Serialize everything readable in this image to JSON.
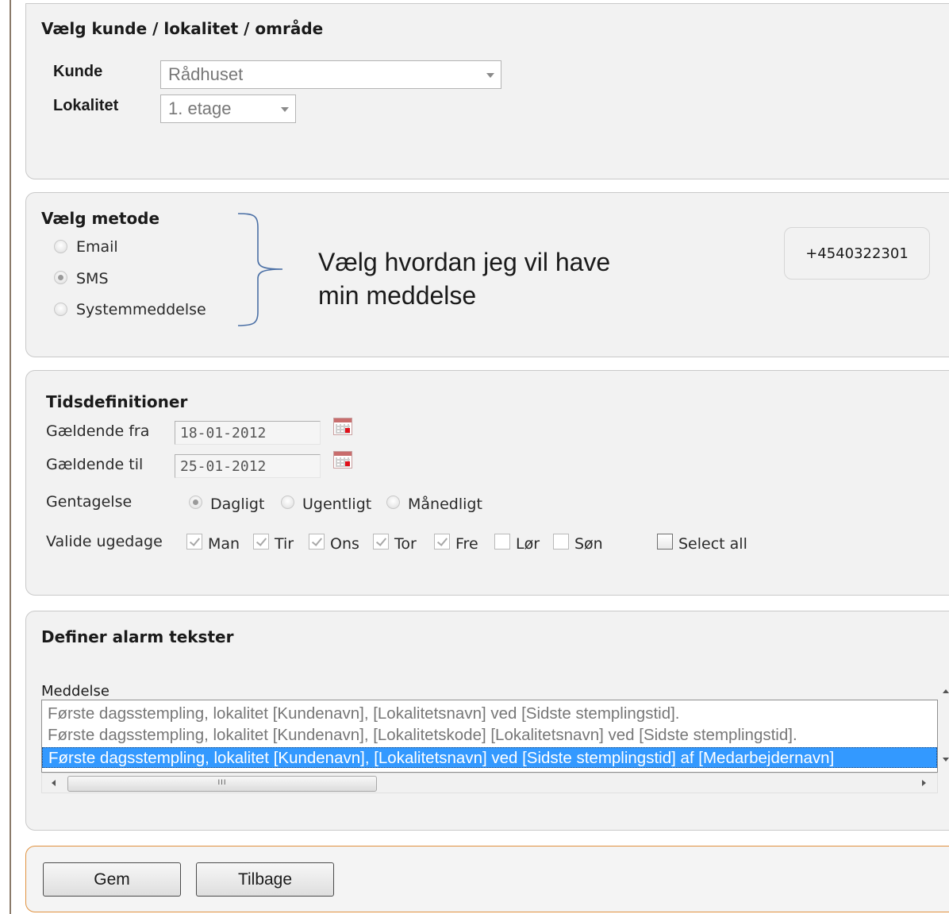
{
  "customer_section": {
    "title": "Vælg kunde / lokalitet / område",
    "customer_label": "Kunde",
    "customer_value": "Rådhuset",
    "location_label": "Lokalitet",
    "location_value": "1. etage"
  },
  "method_section": {
    "title": "Vælg metode",
    "options": [
      {
        "label": "Email",
        "selected": false
      },
      {
        "label": "SMS",
        "selected": true
      },
      {
        "label": "Systemmeddelse",
        "selected": false
      }
    ],
    "annotation_line1": "Vælg hvordan jeg vil have",
    "annotation_line2": "min meddelse",
    "phone_number": "+4540322301"
  },
  "time_section": {
    "title": "Tidsdefinitioner",
    "from_label": "Gældende fra",
    "from_value": "18-01-2012",
    "to_label": "Gældende til",
    "to_value": "25-01-2012",
    "repeat_label": "Gentagelse",
    "repeat_options": [
      {
        "label": "Dagligt",
        "selected": true
      },
      {
        "label": "Ugentligt",
        "selected": false
      },
      {
        "label": "Månedligt",
        "selected": false
      }
    ],
    "weekdays_label": "Valide ugedage",
    "weekdays": [
      {
        "label": "Man",
        "checked": true
      },
      {
        "label": "Tir",
        "checked": true
      },
      {
        "label": "Ons",
        "checked": true
      },
      {
        "label": "Tor",
        "checked": true
      },
      {
        "label": "Fre",
        "checked": true
      },
      {
        "label": "Lør",
        "checked": false
      },
      {
        "label": "Søn",
        "checked": false
      }
    ],
    "select_all_label": "Select all"
  },
  "alarm_section": {
    "title": "Definer alarm tekster",
    "message_label": "Meddelse",
    "messages": [
      {
        "text": "Første dagsstempling, lokalitet [Kundenavn], [Lokalitetsnavn] ved [Sidste stemplingstid].",
        "selected": false
      },
      {
        "text": "Første dagsstempling, lokalitet [Kundenavn], [Lokalitetskode] [Lokalitetsnavn] ved [Sidste stemplingstid].",
        "selected": false
      },
      {
        "text": "Første dagsstempling, lokalitet [Kundenavn], [Lokalitetsnavn] ved [Sidste stemplingstid] af [Medarbejdernavn]",
        "selected": true
      }
    ],
    "scrollbar_grip": "III"
  },
  "actions": {
    "save_label": "Gem",
    "back_label": "Tilbage"
  },
  "colors": {
    "selection": "#3399ff",
    "action_panel_border": "#e0913e",
    "panel_bg": "#f2f2f2"
  }
}
